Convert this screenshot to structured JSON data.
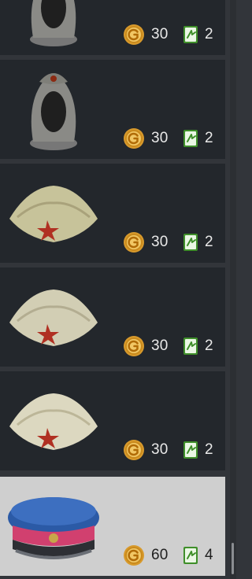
{
  "colors": {
    "panel_background": "#32353a",
    "card_background": "#23272c",
    "card_selected_background": "#cfcfcf",
    "coin_gold": "#e7b24a",
    "card_icon_green": "#3f8f2a"
  },
  "items": [
    {
      "image": "balaclava-with-star-cap",
      "price": "30",
      "card_count": "2",
      "selected": false
    },
    {
      "image": "balaclava-with-star-cap",
      "price": "30",
      "card_count": "2",
      "selected": false
    },
    {
      "image": "pilotka-side-cap-star",
      "price": "30",
      "card_count": "2",
      "selected": false
    },
    {
      "image": "pilotka-side-cap-star",
      "price": "30",
      "card_count": "2",
      "selected": false
    },
    {
      "image": "pilotka-side-cap-star",
      "price": "30",
      "card_count": "2",
      "selected": false
    },
    {
      "image": "blue-red-peaked-officer-cap",
      "price": "60",
      "card_count": "4",
      "selected": true
    }
  ],
  "icons": {
    "currency": "gold-coin-icon",
    "card": "green-card-icon"
  }
}
